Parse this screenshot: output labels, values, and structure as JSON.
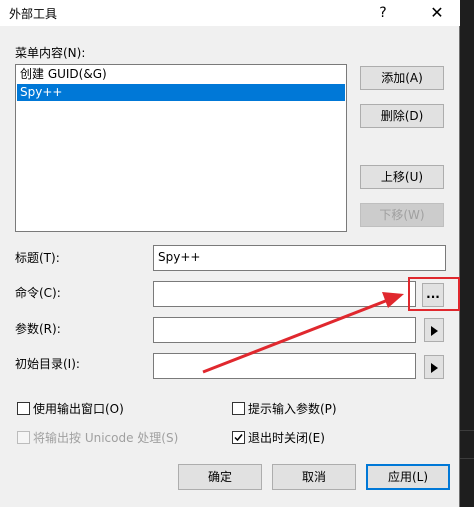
{
  "dialog": {
    "title": "外部工具",
    "help_glyph": "?",
    "close_glyph": "✕"
  },
  "menu": {
    "label": "菜单内容(N):",
    "items": [
      {
        "label": "创建 GUID(&G)",
        "selected": false
      },
      {
        "label": "Spy++",
        "selected": true
      }
    ]
  },
  "buttons": {
    "add": "添加(A)",
    "delete": "删除(D)",
    "move_up": "上移(U)",
    "move_down": "下移(W)",
    "browse": "...",
    "ok": "确定",
    "cancel": "取消",
    "apply": "应用(L)"
  },
  "fields": {
    "title": {
      "label": "标题(T):",
      "value": "Spy++"
    },
    "command": {
      "label": "命令(C):",
      "value": ""
    },
    "arguments": {
      "label": "参数(R):",
      "value": ""
    },
    "initial_dir": {
      "label": "初始目录(I):",
      "value": ""
    }
  },
  "checkboxes": {
    "use_output_window": {
      "label": "使用输出窗口(O)",
      "checked": false,
      "enabled": true
    },
    "prompt_arguments": {
      "label": "提示输入参数(P)",
      "checked": false,
      "enabled": true
    },
    "treat_output_unicode": {
      "label": "将输出按 Unicode 处理(S)",
      "checked": false,
      "enabled": false
    },
    "close_on_exit": {
      "label": "退出时关闭(E)",
      "checked": true,
      "enabled": true
    }
  },
  "icons": {
    "help": "help-icon",
    "close": "close-icon",
    "arrow_right": "triangle-right-icon",
    "checkmark": "checkmark-icon"
  },
  "colors": {
    "selection": "#0078d7",
    "annotation": "#e0282e",
    "dialog_bg": "#f0f0f0"
  }
}
